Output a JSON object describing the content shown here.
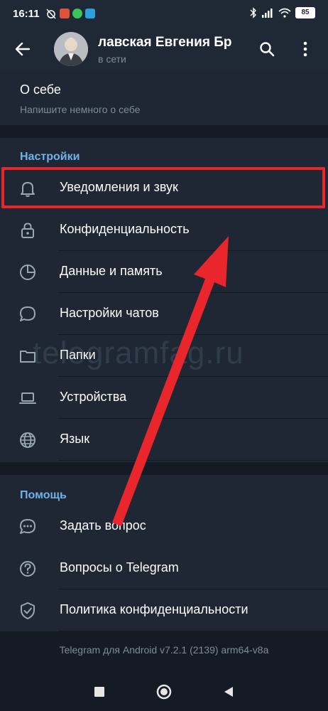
{
  "status_bar": {
    "time": "16:11",
    "battery": "85"
  },
  "profile": {
    "name": "лавская   Евгения Бр",
    "status": "в сети"
  },
  "about": {
    "title": "О себе",
    "hint": "Напишите немного о себе"
  },
  "settings": {
    "header": "Настройки",
    "items": [
      {
        "label": "Уведомления и звук",
        "icon": "bell-icon"
      },
      {
        "label": "Конфиденциальность",
        "icon": "lock-icon"
      },
      {
        "label": "Данные и память",
        "icon": "pie-chart-icon"
      },
      {
        "label": "Настройки чатов",
        "icon": "chat-bubble-icon"
      },
      {
        "label": "Папки",
        "icon": "folder-icon"
      },
      {
        "label": "Устройства",
        "icon": "laptop-icon"
      },
      {
        "label": "Язык",
        "icon": "globe-icon"
      }
    ]
  },
  "help": {
    "header": "Помощь",
    "items": [
      {
        "label": "Задать вопрос",
        "icon": "chat-dots-icon"
      },
      {
        "label": "Вопросы о Telegram",
        "icon": "question-icon"
      },
      {
        "label": "Политика конфиденциальности",
        "icon": "shield-check-icon"
      }
    ]
  },
  "version": "Telegram для Android v7.2.1 (2139) arm64-v8a",
  "watermark": "telegramfag.ru",
  "colors": {
    "accent": "#6fb3ea",
    "highlight": "#e8262b",
    "background": "#1e2733"
  }
}
